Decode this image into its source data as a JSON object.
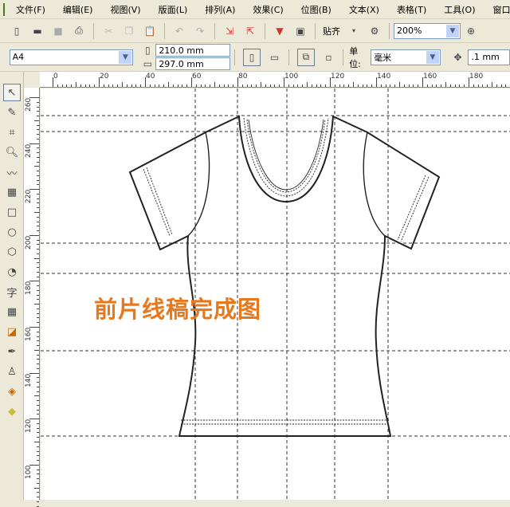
{
  "menu": [
    "文件(F)",
    "编辑(E)",
    "视图(V)",
    "版面(L)",
    "排列(A)",
    "效果(C)",
    "位图(B)",
    "文本(X)",
    "表格(T)",
    "工具(O)",
    "窗口"
  ],
  "toolbar": {
    "snap_label": "贴齐",
    "zoom": "200%"
  },
  "property_bar": {
    "paper": "A4",
    "width": "210.0 mm",
    "height": "297.0 mm",
    "unit_label": "单位:",
    "unit": "毫米",
    "nudge": ".1 mm"
  },
  "ruler_top": [
    "0",
    "20",
    "40",
    "60",
    "80",
    "100",
    "120",
    "140",
    "160",
    "180"
  ],
  "ruler_left": [
    "260",
    "240",
    "220",
    "200",
    "180",
    "160",
    "140",
    "120",
    "100"
  ],
  "caption": "前片线稿完成图",
  "colors": {
    "caption": "#e8781e",
    "guide": "#333333"
  }
}
